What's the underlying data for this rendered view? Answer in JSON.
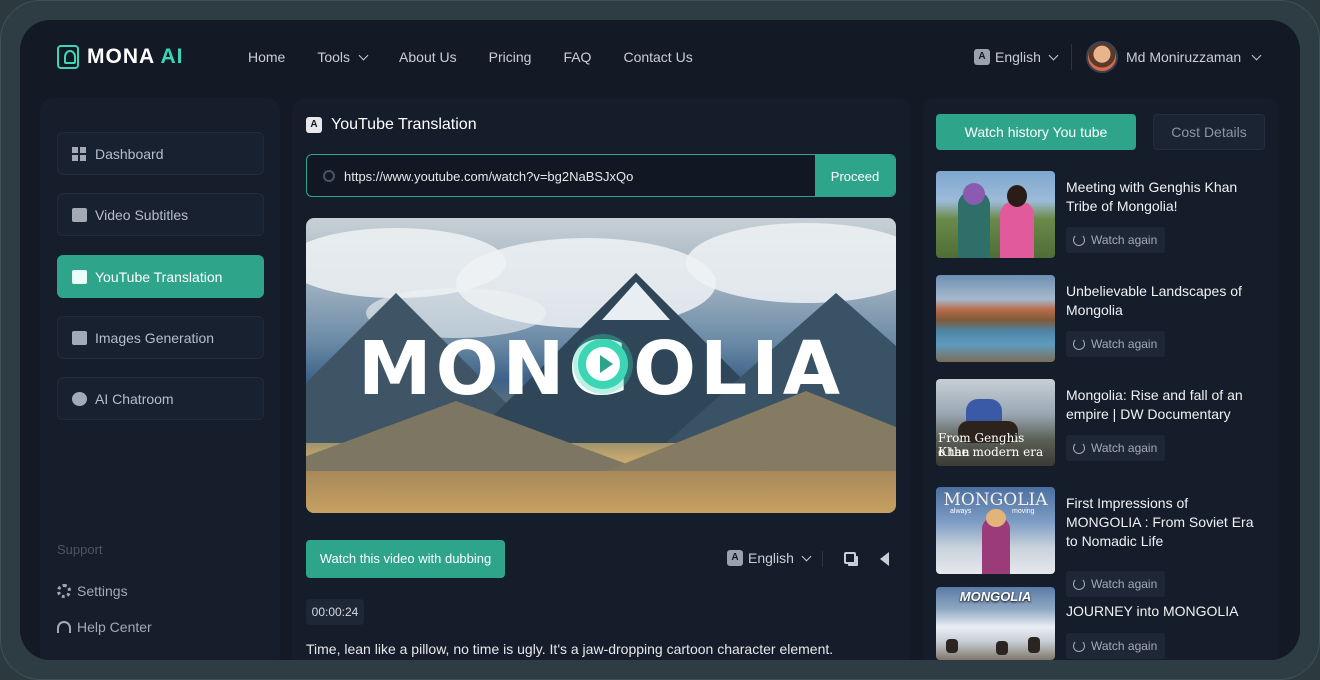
{
  "brand": {
    "name": "MONA",
    "accent": "AI",
    "accent_color": "#3dd6b5"
  },
  "nav": {
    "items": [
      {
        "label": "Home"
      },
      {
        "label": "Tools",
        "has_dropdown": true
      },
      {
        "label": "About Us"
      },
      {
        "label": "Pricing"
      },
      {
        "label": "FAQ"
      },
      {
        "label": "Contact Us"
      }
    ],
    "language": "English",
    "user_name": "Md Moniruzzaman"
  },
  "sidebar": {
    "items": [
      {
        "label": "Dashboard",
        "icon": "dashboard-icon"
      },
      {
        "label": "Video Subtitles",
        "icon": "cc-icon"
      },
      {
        "label": "YouTube Translation",
        "icon": "translate-icon",
        "active": true
      },
      {
        "label": "Images Generation",
        "icon": "image-icon"
      },
      {
        "label": "AI Chatroom",
        "icon": "chat-icon"
      }
    ],
    "support_heading": "Support",
    "settings_label": "Settings",
    "help_label": "Help Center"
  },
  "main": {
    "title": "YouTube Translation",
    "url_value": "https://www.youtube.com/watch?v=bg2NaBSJxQo",
    "proceed_label": "Proceed",
    "video_title_text": "MONGOLIA",
    "dub_button_label": "Watch this video with dubbing",
    "language": "English",
    "timestamp": "00:00:24",
    "transcript": "Time, lean like a pillow, no time is ugly. It's a jaw-dropping cartoon character element."
  },
  "history": {
    "tab_active": "Watch history You tube",
    "tab_inactive": "Cost Details",
    "watch_again_label": "Watch again",
    "items": [
      {
        "title": "Meeting with Genghis Khan Tribe of Mongolia!"
      },
      {
        "title": "Unbelievable Landscapes of Mongolia"
      },
      {
        "title": "Mongolia: Rise and fall of an empire | DW Documentary",
        "thumb_text_1": "From Genghis Khan",
        "thumb_text_2": "o the modern era"
      },
      {
        "title": "First Impressions of MONGOLIA : From Soviet Era to Nomadic Life",
        "thumb_text_1": "MONGOLIA",
        "thumb_text_2": "always",
        "thumb_text_3": "moving"
      },
      {
        "title": "JOURNEY into MONGOLIA",
        "thumb_text_1": "MONGOLIA"
      }
    ]
  }
}
